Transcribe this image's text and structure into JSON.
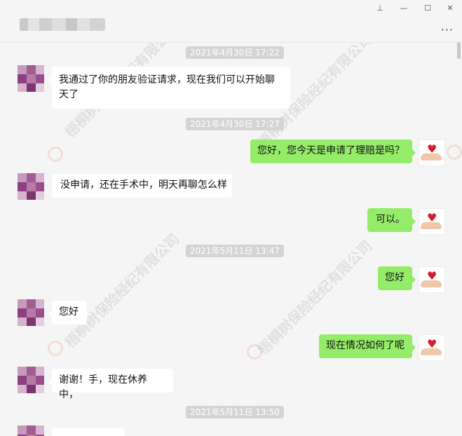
{
  "window": {
    "pin_icon": "pin-icon",
    "minimize_icon": "minimize-icon",
    "maximize_icon": "maximize-icon",
    "close_icon": "close-icon",
    "more_icon": "more-dots-icon",
    "more_glyph": "···"
  },
  "watermark": {
    "text": "梧桐树保险经纪有限公司"
  },
  "messages": [
    {
      "type": "timestamp",
      "text": "2021年4月30日 17:22"
    },
    {
      "type": "in",
      "text": "我通过了你的朋友验证请求，现在我们可以开始聊天了"
    },
    {
      "type": "timestamp",
      "text": "2021年4月30日 17:27"
    },
    {
      "type": "out",
      "text": "您好，您今天是申请了理赔是吗？"
    },
    {
      "type": "in",
      "text": "没申请，还在手术中，明天再聊怎么样"
    },
    {
      "type": "out",
      "text": "可以。"
    },
    {
      "type": "timestamp",
      "text": "2021年5月11日 13:47"
    },
    {
      "type": "out",
      "text": "您好"
    },
    {
      "type": "in",
      "text": "您好"
    },
    {
      "type": "out",
      "text": "现在情况如何了呢"
    },
    {
      "type": "in",
      "text": "谢谢！手，现在休养中，"
    },
    {
      "type": "timestamp",
      "text": "2021年5月11日 13:50"
    }
  ],
  "colors": {
    "out_bubble": "#95ec69",
    "in_bubble": "#ffffff",
    "timestamp_bg": "#d4d4d4"
  }
}
